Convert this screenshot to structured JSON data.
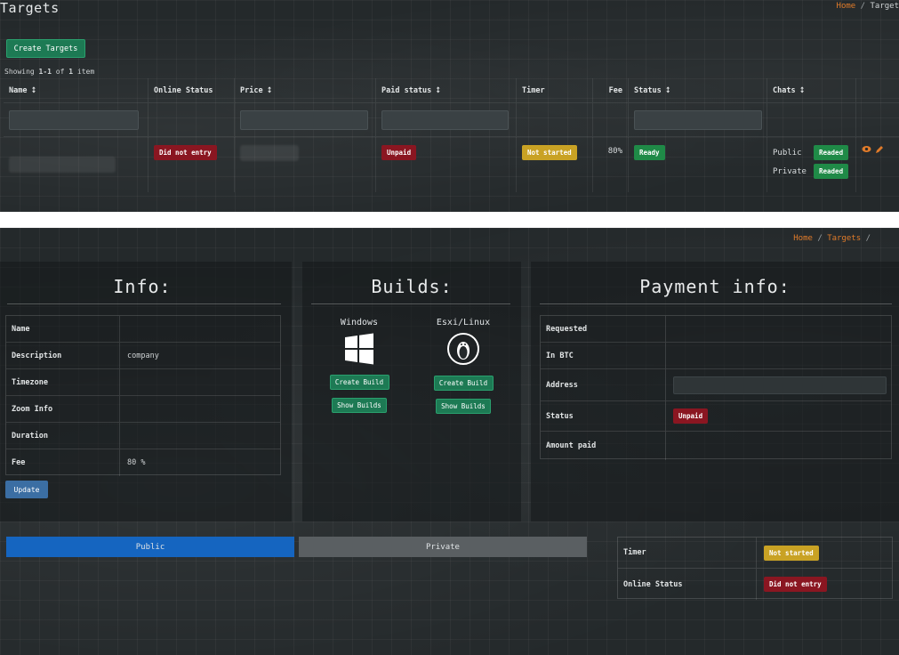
{
  "top": {
    "title": "Targets",
    "breadcrumb": {
      "home": "Home",
      "sep": "/",
      "current": "Target"
    },
    "create_button": "Create Targets",
    "summary": {
      "prefix": "Showing ",
      "range": "1-1",
      "middle": " of ",
      "total": "1",
      "suffix": " item"
    },
    "columns": [
      "Name ⭥",
      "Online Status",
      "Price ⭥",
      "Paid status ⭥",
      "Timer",
      "Fee",
      "Status ⭥",
      "Chats ⭥"
    ],
    "row": {
      "online_status": "Did not entry",
      "paid_status": "Unpaid",
      "timer": "Not started",
      "fee": "80%",
      "status": "Ready",
      "chats": [
        {
          "label": "Public",
          "state": "Readed"
        },
        {
          "label": "Private",
          "state": "Readed"
        }
      ]
    }
  },
  "bottom": {
    "breadcrumb": {
      "home": "Home",
      "sep": "/",
      "current": "Targets",
      "sep2": "/"
    },
    "info": {
      "title": "Info:",
      "fields": [
        {
          "label": "Name",
          "value": ""
        },
        {
          "label": "Description",
          "value": "company"
        },
        {
          "label": "Timezone",
          "value": ""
        },
        {
          "label": "Zoom Info",
          "value": ""
        },
        {
          "label": "Duration",
          "value": ""
        },
        {
          "label": "Fee",
          "value": "80 %"
        }
      ],
      "update_button": "Update"
    },
    "builds": {
      "title": "Builds:",
      "platforms": [
        {
          "name": "Windows",
          "icon": "windows-icon",
          "create": "Create Build",
          "show": "Show Builds"
        },
        {
          "name": "Esxi/Linux",
          "icon": "linux-icon",
          "create": "Create Build",
          "show": "Show Builds"
        }
      ]
    },
    "payment": {
      "title": "Payment info:",
      "fields": [
        {
          "label": "Requested",
          "value": ""
        },
        {
          "label": "In BTC",
          "value": ""
        },
        {
          "label": "Address",
          "value": ""
        },
        {
          "label": "Status",
          "value": "Unpaid"
        },
        {
          "label": "Amount paid",
          "value": ""
        }
      ]
    },
    "tabs": {
      "public": "Public",
      "private": "Private"
    },
    "status_table": [
      {
        "label": "Timer",
        "value": "Not started"
      },
      {
        "label": "Online Status",
        "value": "Did not entry"
      }
    ]
  },
  "colors": {
    "accent_orange": "#e07b2a",
    "green": "#1d7a54",
    "red": "#8a1621",
    "yellow": "#c9a224",
    "blue": "#1565c0"
  }
}
